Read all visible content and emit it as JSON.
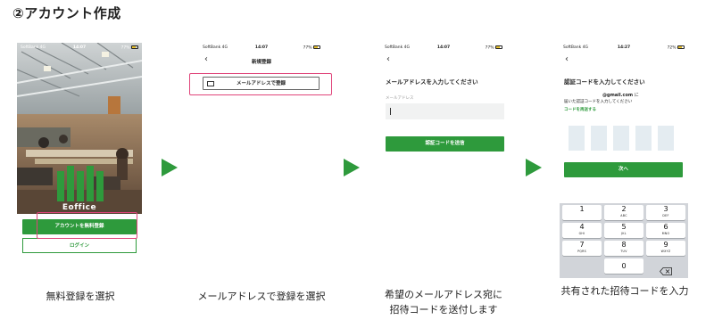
{
  "title": "②アカウント作成",
  "colors": {
    "brand_green": "#2e9a3c",
    "highlight_pink": "#e0447a"
  },
  "screen1": {
    "status": {
      "carrier": "SoftBank 4G",
      "time": "14:07",
      "battery": "77%"
    },
    "logo_text": "Eoffice",
    "signup_button": "アカウントを無料登録",
    "login_button": "ログイン",
    "caption": "無料登録を選択"
  },
  "screen2": {
    "status": {
      "carrier": "SoftBank 4G",
      "time": "14:07",
      "battery": "77%"
    },
    "nav_title": "新規登録",
    "email_signup_button": "メールアドレスで登録",
    "caption": "メールアドレスで登録を選択"
  },
  "screen3": {
    "status": {
      "carrier": "SoftBank 4G",
      "time": "14:07",
      "battery": "77%"
    },
    "heading": "メールアドレスを入力してください",
    "email_placeholder": "メールアドレス",
    "send_code_button": "認証コードを送信",
    "caption_line1": "希望のメールアドレス宛に",
    "caption_line2": "招待コードを送付します"
  },
  "screen4": {
    "status": {
      "carrier": "SoftBank 4G",
      "time": "14:27",
      "battery": "72%"
    },
    "heading": "認証コードを入力してください",
    "email_line": "@gmail.com",
    "email_suffix": "に",
    "sent_message": "届いた認証コードを入力してください",
    "resend_link": "コードを再送する",
    "next_button": "次へ",
    "keypad": [
      {
        "num": "1",
        "letters": ""
      },
      {
        "num": "2",
        "letters": "ABC"
      },
      {
        "num": "3",
        "letters": "DEF"
      },
      {
        "num": "4",
        "letters": "GHI"
      },
      {
        "num": "5",
        "letters": "JKL"
      },
      {
        "num": "6",
        "letters": "MNO"
      },
      {
        "num": "7",
        "letters": "PQRS"
      },
      {
        "num": "8",
        "letters": "TUV"
      },
      {
        "num": "9",
        "letters": "WXYZ"
      },
      {
        "num": "0",
        "letters": ""
      }
    ],
    "caption": "共有された招待コードを入力"
  }
}
